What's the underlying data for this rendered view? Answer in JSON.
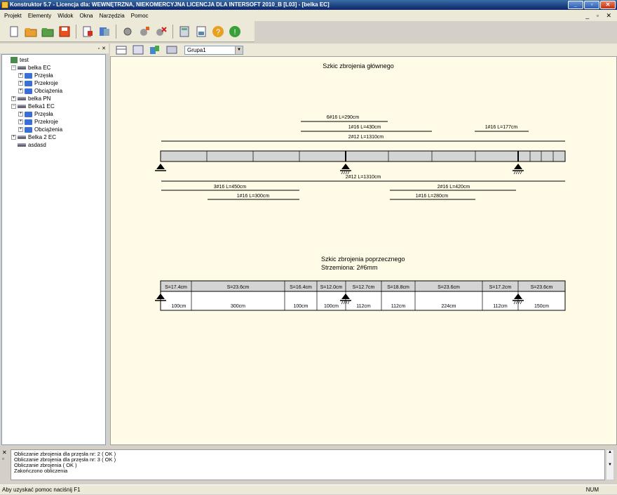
{
  "window": {
    "title": "Konstruktor 5.7 - Licencja dla: WEWNĘTRZNA, NIEKOMERCYJNA LICENCJA DLA INTERSOFT 2010_B [L03] - [belka EC]"
  },
  "menu": [
    "Projekt",
    "Elementy",
    "Widok",
    "Okna",
    "Narzędzia",
    "Pomoc"
  ],
  "toolbar": {
    "group_value": "Grupa1"
  },
  "tree": [
    {
      "label": "test",
      "indent": 0,
      "type": "proj",
      "pm": ""
    },
    {
      "label": "belka EC",
      "indent": 1,
      "type": "beam",
      "pm": "−"
    },
    {
      "label": "Przęsła",
      "indent": 2,
      "type": "folder",
      "pm": "+"
    },
    {
      "label": "Przekroje",
      "indent": 2,
      "type": "folder",
      "pm": "+"
    },
    {
      "label": "Obciążenia",
      "indent": 2,
      "type": "folder",
      "pm": "+"
    },
    {
      "label": "belka PN",
      "indent": 1,
      "type": "beam",
      "pm": "+"
    },
    {
      "label": "Belka1 EC",
      "indent": 1,
      "type": "beam",
      "pm": "−"
    },
    {
      "label": "Przęsła",
      "indent": 2,
      "type": "folder",
      "pm": "+"
    },
    {
      "label": "Przekroje",
      "indent": 2,
      "type": "folder",
      "pm": "+"
    },
    {
      "label": "Obciążenia",
      "indent": 2,
      "type": "folder",
      "pm": "+"
    },
    {
      "label": "Belka 2 EC",
      "indent": 1,
      "type": "beam",
      "pm": "+"
    },
    {
      "label": "asdasd",
      "indent": 1,
      "type": "beam",
      "pm": ""
    }
  ],
  "drawing": {
    "main_title": "Szkic zbrojenia głównego",
    "top_bars": [
      "6#16 L=290cm",
      "1#16 L=430cm",
      "1#16 L=177cm",
      "2#12 L=1310cm"
    ],
    "bottom_bars": [
      "2#12 L=1310cm",
      "3#16 L=450cm",
      "2#16 L=420cm",
      "1#16 L=300cm",
      "1#16 L=280cm"
    ],
    "transverse_title": "Szkic zbrojenia poprzecznego",
    "stirrups_label": "Strzemiona: 2#6mm",
    "spacings": [
      "S=17.4cm",
      "S=23.6cm",
      "S=16.4cm",
      "S=12.0cm",
      "S=12.7cm",
      "S=18.8cm",
      "S=23.6cm",
      "S=17.2cm",
      "S=23.6cm"
    ],
    "lengths": [
      "100cm",
      "300cm",
      "100cm",
      "100cm",
      "112cm",
      "112cm",
      "224cm",
      "112cm",
      "150cm"
    ]
  },
  "log": [
    "Obliczanie zbrojenia dla przęsła nr: 2 ( OK )",
    "Obliczanie zbrojenia dla przęsła nr: 3 ( OK )",
    "Obliczanie zbrojenia ( OK )",
    "Zakończono obliczenia"
  ],
  "status": {
    "help": "Aby uzyskać pomoc naciśnij F1",
    "num": "NUM"
  }
}
